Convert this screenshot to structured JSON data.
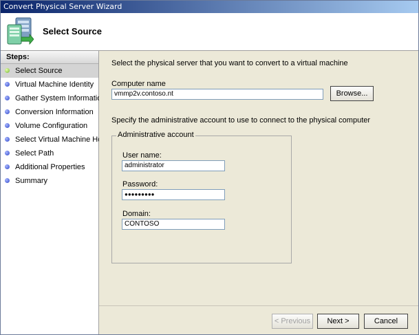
{
  "window": {
    "title": "Convert Physical Server Wizard"
  },
  "header": {
    "title": "Select Source",
    "icon": "server-wizard-icon"
  },
  "steps": {
    "header": "Steps:",
    "items": [
      {
        "label": "Select Source",
        "active": true
      },
      {
        "label": "Virtual Machine Identity"
      },
      {
        "label": "Gather System Information"
      },
      {
        "label": "Conversion Information"
      },
      {
        "label": "Volume Configuration"
      },
      {
        "label": "Select Virtual Machine Host"
      },
      {
        "label": "Select Path"
      },
      {
        "label": "Additional Properties"
      },
      {
        "label": "Summary"
      }
    ]
  },
  "main": {
    "intro": "Select the physical server that you want to convert to a virtual machine",
    "computer_name_label": "Computer name",
    "computer_name_value": "vmmp2v.contoso.nt",
    "browse_label": "Browse...",
    "account_intro": "Specify the administrative account to use to connect to the physical computer",
    "group_title": "Administrative account",
    "username_label": "User name:",
    "username_value": "administrator",
    "password_label": "Password:",
    "password_value": "●●●●●●●●●",
    "domain_label": "Domain:",
    "domain_value": "CONTOSO"
  },
  "footer": {
    "previous_label": "< Previous",
    "next_label": "Next >",
    "cancel_label": "Cancel"
  }
}
